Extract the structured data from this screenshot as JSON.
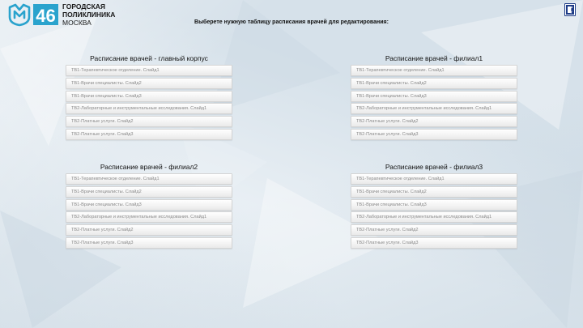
{
  "brand": {
    "logo_number": "46",
    "line1": "ГОРОДСКАЯ",
    "line2": "ПОЛИКЛИНИКА",
    "city": "МОСКВА",
    "accent": "#2aa3cd"
  },
  "prompt": "Выберете нужную таблицу расписания врачей для редактирования:",
  "exit_icon": "door-exit-icon",
  "panels": [
    {
      "title": "Расписание врачей - главный корпус",
      "buttons": [
        "ТВ1-Терапевтическое отделение. Слайд1",
        "ТВ1-Врачи специалисты. Слайд2",
        "ТВ1-Врачи специалисты. Слайд3",
        "ТВ2-Лабораторные и инструментальные исследования. Слайд1",
        "ТВ2-Платные услуги. Слайд2",
        "ТВ2-Платные услуги. Слайд3"
      ]
    },
    {
      "title": "Расписание врачей - филиал1",
      "buttons": [
        "ТВ1-Терапевтическое отделение. Слайд1",
        "ТВ1-Врачи специалисты. Слайд2",
        "ТВ1-Врачи специалисты. Слайд3",
        "ТВ2-Лабораторные и инструментальные исследования. Слайд1",
        "ТВ2-Платные услуги. Слайд2",
        "ТВ2-Платные услуги. Слайд3"
      ]
    },
    {
      "title": "Расписание врачей - филиал2",
      "buttons": [
        "ТВ1-Терапевтическое отделение. Слайд1",
        "ТВ1-Врачи специалисты. Слайд2",
        "ТВ1-Врачи специалисты. Слайд3",
        "ТВ2-Лабораторные и инструментальные исследования. Слайд1",
        "ТВ2-Платные услуги. Слайд2",
        "ТВ2-Платные услуги. Слайд3"
      ]
    },
    {
      "title": "Расписание врачей - филиал3",
      "buttons": [
        "ТВ1-Терапевтическое отделение. Слайд1",
        "ТВ1-Врачи специалисты. Слайд2",
        "ТВ1-Врачи специалисты. Слайд3",
        "ТВ2-Лабораторные и инструментальные исследования. Слайд1",
        "ТВ2-Платные услуги. Слайд2",
        "ТВ2-Платные услуги. Слайд3"
      ]
    }
  ]
}
